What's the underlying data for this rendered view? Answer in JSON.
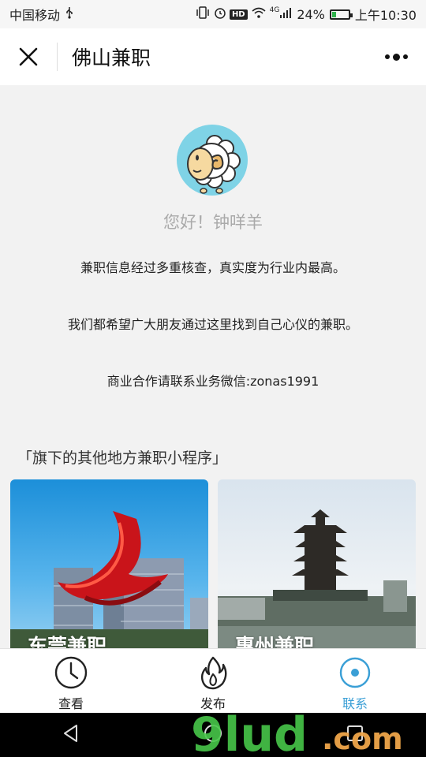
{
  "status_bar": {
    "carrier": "中国移动",
    "network": "4G",
    "battery_percent": "24%",
    "time": "上午10:30",
    "hd": "HD",
    "battery_level": 0.24
  },
  "nav": {
    "title": "佛山兼职"
  },
  "profile": {
    "greeting": "您好！钟咩羊"
  },
  "info": {
    "line1": "兼职信息经过多重核查，真实度为行业内最高。",
    "line2": "我们都希望广大朋友通过这里找到自己心仪的兼职。",
    "line3": "商业合作请联系业务微信:zonas1991"
  },
  "section": {
    "title": "「旗下的其他地方兼职小程序」"
  },
  "cards": [
    {
      "label": "东莞兼职"
    },
    {
      "label": "惠州兼职"
    }
  ],
  "tabs": [
    {
      "label": "查看",
      "icon": "clock-icon",
      "active": false
    },
    {
      "label": "发布",
      "icon": "flame-icon",
      "active": false
    },
    {
      "label": "联系",
      "icon": "target-icon",
      "active": true
    }
  ],
  "watermark": {
    "text": "9lud.com"
  },
  "colors": {
    "accent": "#3a9fd6",
    "watermark_green": "#48c74a",
    "watermark_orange": "#f0a64a"
  }
}
